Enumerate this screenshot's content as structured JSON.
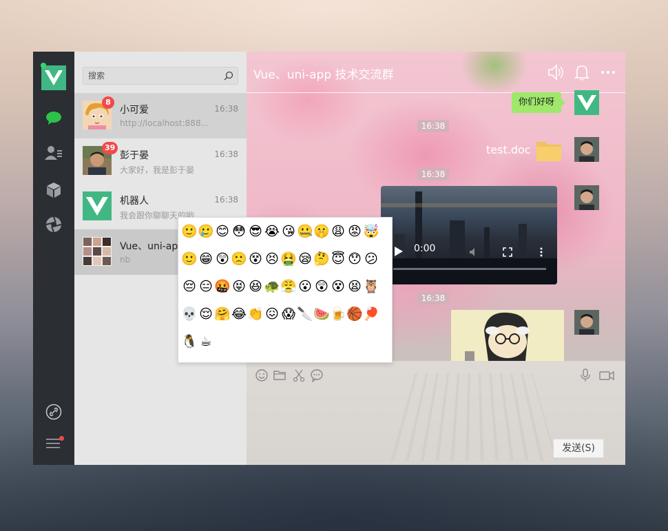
{
  "nav": {
    "icons": [
      "vue-logo-icon",
      "chat-icon",
      "contacts-icon",
      "cube-icon",
      "aperture-icon",
      "link-icon",
      "menu-icon"
    ]
  },
  "search": {
    "placeholder": "搜索"
  },
  "contacts": [
    {
      "name": "小可爱",
      "time": "16:38",
      "preview": "http://localhost:8888...",
      "badge": "8"
    },
    {
      "name": "彭于晏",
      "time": "16:38",
      "preview": "大家好，我是彭于晏",
      "badge": "39"
    },
    {
      "name": "机器人",
      "time": "16:38",
      "preview": "我会跟你聊聊天的哟"
    },
    {
      "name": "Vue、uni-app",
      "time": "",
      "preview": "nb"
    }
  ],
  "chat": {
    "title": "Vue、uni-app 技术交流群",
    "messages": {
      "greeting": "你们好呀",
      "file_name": "test.doc",
      "video_time": "0:00"
    },
    "times": [
      "16:38",
      "16:38",
      "16:38"
    ],
    "send_label": "发送(S)"
  },
  "emojis": [
    "🙂",
    "🥲",
    "😊",
    "😳",
    "😎",
    "😭",
    "😘",
    "🤐",
    "🤫",
    "😩",
    "😡",
    "🤯",
    "🙂",
    "😁",
    "😲",
    "🙁",
    "😵",
    "😣",
    "🤮",
    "😪",
    "🤔",
    "😇",
    "😯",
    "😕",
    "😔",
    "😑",
    "🤬",
    "😝",
    "😆",
    "🐢",
    "😤",
    "😮",
    "😲",
    "😵",
    "😫",
    "🦉",
    "💀",
    "😌",
    "🤗",
    "😂",
    "👏",
    "😖",
    "😱",
    "🔪",
    "🍉",
    "🍺",
    "🏀",
    "🏓",
    "🐧",
    "☕"
  ],
  "colors": {
    "nav_bg": "#2b2e33",
    "list_bg": "#e6e6e6",
    "vue_green": "#41b883",
    "bubble_green": "#9fe86b",
    "badge_red": "#f04a4a"
  }
}
